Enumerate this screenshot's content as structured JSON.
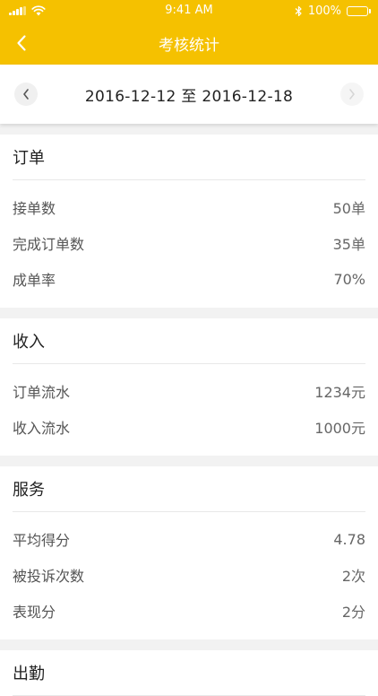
{
  "status_bar": {
    "time": "9:41 AM",
    "battery": "100%"
  },
  "nav": {
    "title": "考核统计"
  },
  "date_range": {
    "text": "2016-12-12 至 2016-12-18"
  },
  "sections": [
    {
      "title": "订单",
      "rows": [
        {
          "label": "接单数",
          "value": "50单"
        },
        {
          "label": "完成订单数",
          "value": "35单"
        },
        {
          "label": "成单率",
          "value": "70%"
        }
      ]
    },
    {
      "title": "收入",
      "rows": [
        {
          "label": "订单流水",
          "value": "1234元"
        },
        {
          "label": "收入流水",
          "value": "1000元"
        }
      ]
    },
    {
      "title": "服务",
      "rows": [
        {
          "label": "平均得分",
          "value": "4.78"
        },
        {
          "label": "被投诉次数",
          "value": "2次"
        },
        {
          "label": "表现分",
          "value": "2分"
        }
      ]
    },
    {
      "title": "出勤",
      "rows": []
    }
  ],
  "colors": {
    "accent": "#f5c100",
    "background": "#f2f2f2"
  }
}
